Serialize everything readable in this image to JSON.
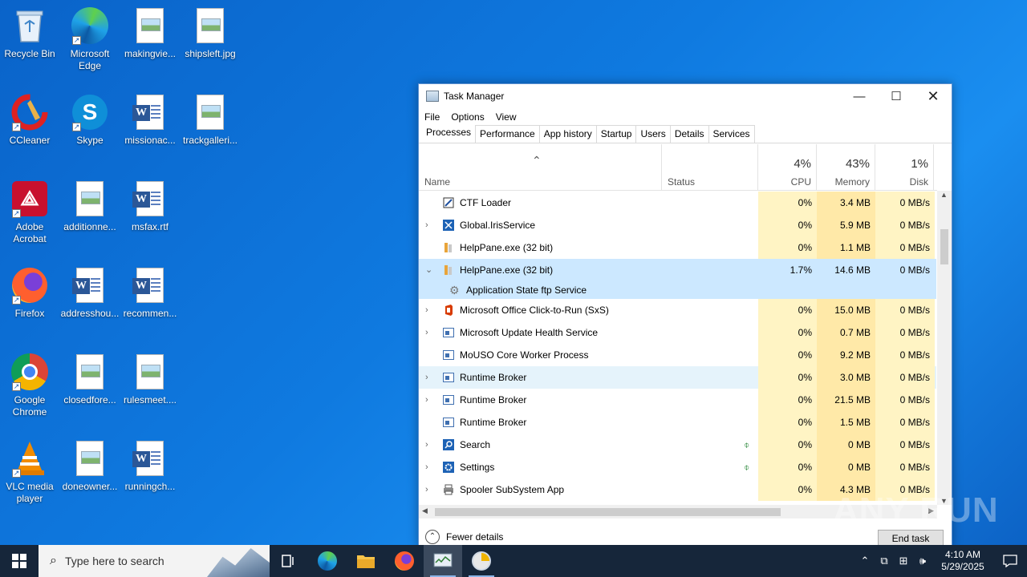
{
  "desktop": {
    "icons": [
      {
        "label": "Recycle Bin"
      },
      {
        "label": "Microsoft Edge"
      },
      {
        "label": "makingvie..."
      },
      {
        "label": "shipsleft.jpg"
      },
      {
        "label": "CCleaner"
      },
      {
        "label": "Skype"
      },
      {
        "label": "missionac..."
      },
      {
        "label": "trackgalleri..."
      },
      {
        "label": "Adobe Acrobat"
      },
      {
        "label": "additionne..."
      },
      {
        "label": "msfax.rtf"
      },
      {
        "label": "Firefox"
      },
      {
        "label": "addresshou..."
      },
      {
        "label": "recommen..."
      },
      {
        "label": "Google Chrome"
      },
      {
        "label": "closedfore..."
      },
      {
        "label": "rulesmeet...."
      },
      {
        "label": "VLC media player"
      },
      {
        "label": "doneowner..."
      },
      {
        "label": "runningch..."
      }
    ]
  },
  "task_manager": {
    "title": "Task Manager",
    "menu": [
      "File",
      "Options",
      "View"
    ],
    "tabs": [
      "Processes",
      "Performance",
      "App history",
      "Startup",
      "Users",
      "Details",
      "Services"
    ],
    "active_tab": "Processes",
    "columns": {
      "name": "Name",
      "status": "Status",
      "cpu": {
        "label": "CPU",
        "percent": "4%"
      },
      "memory": {
        "label": "Memory",
        "percent": "43%"
      },
      "disk": {
        "label": "Disk",
        "percent": "1%"
      }
    },
    "sort_indicator": "⌃",
    "rows": [
      {
        "name": "CTF Loader",
        "expandable": false,
        "cpu": "0%",
        "mem": "3.4 MB",
        "disk": "0 MB/s"
      },
      {
        "name": "Global.IrisService",
        "expandable": true,
        "cpu": "0%",
        "mem": "5.9 MB",
        "disk": "0 MB/s"
      },
      {
        "name": "HelpPane.exe (32 bit)",
        "expandable": false,
        "cpu": "0%",
        "mem": "1.1 MB",
        "disk": "0 MB/s"
      },
      {
        "name": "HelpPane.exe (32 bit)",
        "expandable": true,
        "expanded": true,
        "selected": true,
        "cpu": "1.7%",
        "mem": "14.6 MB",
        "disk": "0 MB/s"
      },
      {
        "name": "Microsoft Office Click-to-Run (SxS)",
        "expandable": true,
        "cpu": "0%",
        "mem": "15.0 MB",
        "disk": "0 MB/s"
      },
      {
        "name": "Microsoft Update Health Service",
        "expandable": true,
        "cpu": "0%",
        "mem": "0.7 MB",
        "disk": "0 MB/s"
      },
      {
        "name": "MoUSO Core Worker Process",
        "expandable": false,
        "cpu": "0%",
        "mem": "9.2 MB",
        "disk": "0 MB/s"
      },
      {
        "name": "Runtime Broker",
        "expandable": true,
        "hover": true,
        "cpu": "0%",
        "mem": "3.0 MB",
        "disk": "0 MB/s"
      },
      {
        "name": "Runtime Broker",
        "expandable": true,
        "cpu": "0%",
        "mem": "21.5 MB",
        "disk": "0 MB/s"
      },
      {
        "name": "Runtime Broker",
        "expandable": false,
        "cpu": "0%",
        "mem": "1.5 MB",
        "disk": "0 MB/s"
      },
      {
        "name": "Search",
        "expandable": true,
        "suspended": true,
        "cpu": "0%",
        "mem": "0 MB",
        "disk": "0 MB/s"
      },
      {
        "name": "Settings",
        "expandable": true,
        "suspended": true,
        "cpu": "0%",
        "mem": "0 MB",
        "disk": "0 MB/s"
      },
      {
        "name": "Spooler SubSystem App",
        "expandable": true,
        "cpu": "0%",
        "mem": "4.3 MB",
        "disk": "0 MB/s"
      }
    ],
    "child_row": {
      "name": "Application State ftp Service"
    },
    "fewer_details": "Fewer details",
    "end_task": "End task"
  },
  "taskbar": {
    "search_placeholder": "Type here to search",
    "time": "4:10 AM",
    "date": "5/29/2025"
  },
  "watermark": "ANY RUN"
}
